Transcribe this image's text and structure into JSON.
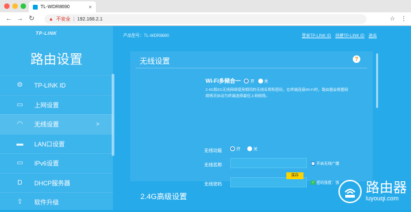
{
  "browser": {
    "tab_title": "TL-WDR8690",
    "insecure_label": "不安全",
    "url": "192.168.2.1"
  },
  "app": {
    "logo": "TP-LINK",
    "side_title": "路由设置",
    "product_info": "产品型号：TL-WDR8690",
    "links": [
      "登录TP-LINK ID",
      "创建TP-LINK ID",
      "退出"
    ]
  },
  "menu": [
    {
      "label": "TP-LINK ID",
      "icon": "gear-icon",
      "glyph": "⚙"
    },
    {
      "label": "上网设置",
      "icon": "laptop-icon",
      "glyph": "▭"
    },
    {
      "label": "无线设置",
      "icon": "wifi-icon",
      "glyph": "◠",
      "active": true,
      "arrow": ">"
    },
    {
      "label": "LAN口设置",
      "icon": "lan-port-icon",
      "glyph": "▬"
    },
    {
      "label": "IPv6设置",
      "icon": "laptop-icon",
      "glyph": "▭"
    },
    {
      "label": "DHCP服务器",
      "icon": "dhcp-icon",
      "glyph": "D"
    },
    {
      "label": "软件升级",
      "icon": "upload-icon",
      "glyph": "⇪"
    }
  ],
  "panel": {
    "title": "无线设置",
    "help": "?",
    "wifi_multi_label": "Wi-Fi多频合一",
    "on": "开",
    "off": "关",
    "desc": "2.4G和5G无线网络使用相同的无线名称和密码，在终端连接Wi-Fi时，路由器会根据网络情况自动为终端选择最佳上网频段。",
    "wifi_switch_label": "无线功能",
    "ssid_label": "无线名称",
    "ssid_value": "",
    "password_label": "无线密码",
    "password_value": "",
    "broadcast_label": "开启无线广播",
    "strength_label": "密码强度：强",
    "save_label": "保存"
  },
  "section2_title": "2.4G高级设置",
  "watermark": {
    "cn": "路由器",
    "url": "luyouqi.com"
  }
}
